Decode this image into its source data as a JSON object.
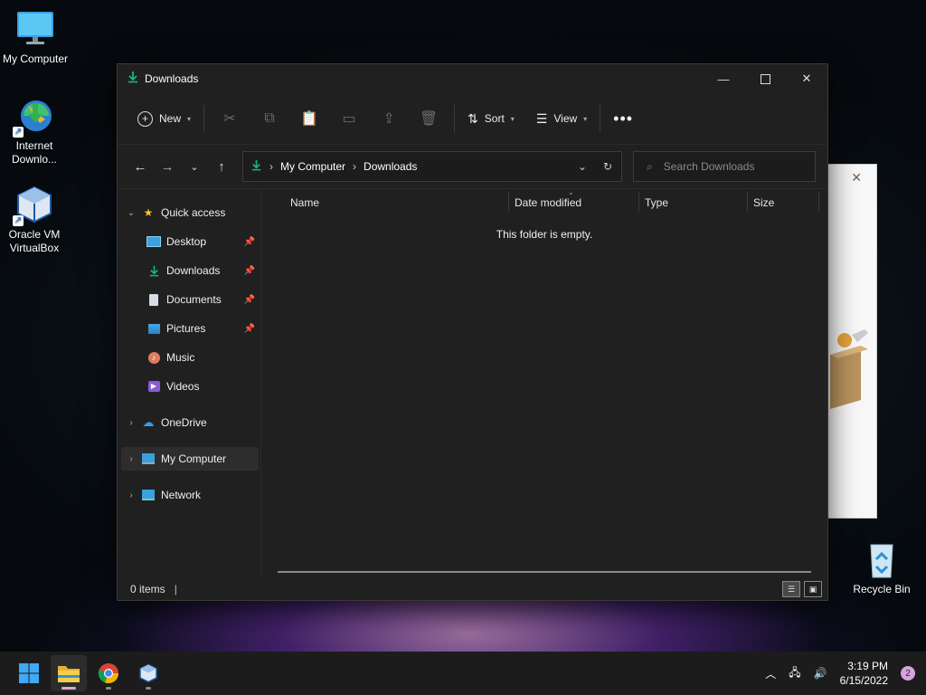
{
  "desktop": {
    "icons": [
      {
        "label": "My Computer"
      },
      {
        "label": "Internet Downlo..."
      },
      {
        "label": "Oracle VM VirtualBox"
      },
      {
        "label": "Recycle Bin"
      }
    ]
  },
  "explorer": {
    "title": "Downloads",
    "toolbar": {
      "new_label": "New",
      "sort_label": "Sort",
      "view_label": "View"
    },
    "address": {
      "crumbs": [
        "My Computer",
        "Downloads"
      ]
    },
    "search": {
      "placeholder": "Search Downloads"
    },
    "nav": {
      "quick_access": "Quick access",
      "items": [
        {
          "label": "Desktop",
          "pinned": true
        },
        {
          "label": "Downloads",
          "pinned": true
        },
        {
          "label": "Documents",
          "pinned": true
        },
        {
          "label": "Pictures",
          "pinned": true
        },
        {
          "label": "Music",
          "pinned": false
        },
        {
          "label": "Videos",
          "pinned": false
        }
      ],
      "onedrive": "OneDrive",
      "my_computer": "My Computer",
      "network": "Network"
    },
    "columns": [
      "Name",
      "Date modified",
      "Type",
      "Size"
    ],
    "empty_message": "This folder is empty.",
    "status": "0 items"
  },
  "taskbar": {
    "time": "3:19 PM",
    "date": "6/15/2022",
    "notifications": "2"
  },
  "colors": {
    "accent": "#0f9d8f",
    "folder": "#f0c040",
    "selected": "#2d2d2d"
  }
}
